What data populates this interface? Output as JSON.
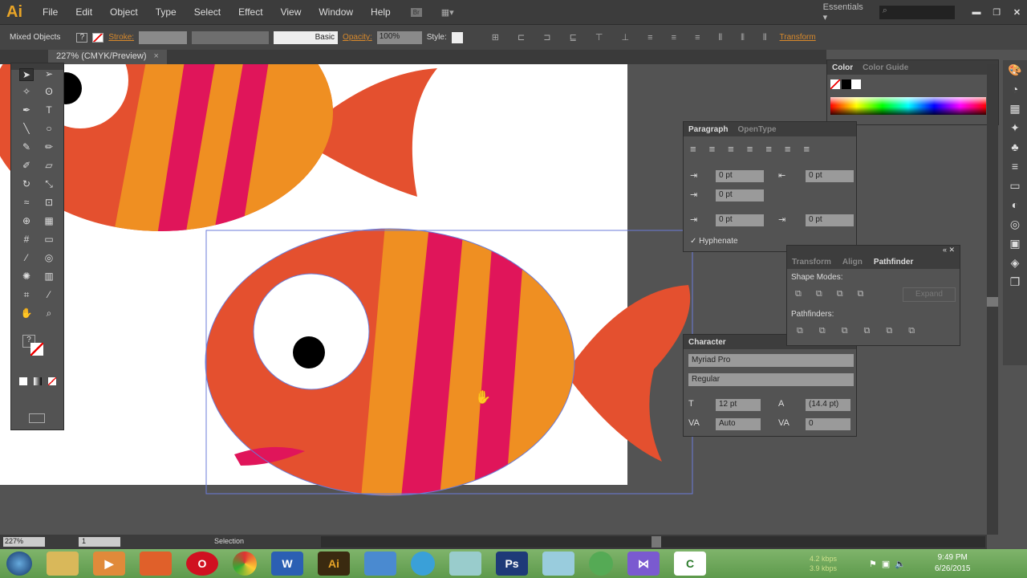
{
  "app": {
    "logo": "Ai",
    "menus": [
      "File",
      "Edit",
      "Object",
      "Type",
      "Select",
      "Effect",
      "View",
      "Window",
      "Help"
    ],
    "workspace": "Essentials",
    "bridge": "Br"
  },
  "control": {
    "selection": "Mixed Objects",
    "fill": "?",
    "stroke_label": "Stroke:",
    "brush": "Basic",
    "opacity_label": "Opacity:",
    "opacity": "100%",
    "style_label": "Style:",
    "transform": "Transform"
  },
  "document": {
    "tab": "227% (CMYK/Preview)"
  },
  "colors": {
    "body": "#e4502f",
    "orange": "#ef8f22",
    "pink": "#e0155a",
    "accent": "#d8892b"
  },
  "color_panel": {
    "tabs": [
      "Color",
      "Color Guide"
    ]
  },
  "paragraph": {
    "tabs": [
      "Paragraph",
      "OpenType"
    ],
    "left_indent": "0 pt",
    "right_indent": "0 pt",
    "first_line": "0 pt",
    "space_before": "0 pt",
    "space_after": "0 pt",
    "hyphenate": "Hyphenate"
  },
  "pathfinder": {
    "tabs": [
      "Transform",
      "Align",
      "Pathfinder"
    ],
    "shape_modes": "Shape Modes:",
    "expand": "Expand",
    "pathfinders": "Pathfinders:"
  },
  "character": {
    "title": "Character",
    "font": "Myriad Pro",
    "style": "Regular",
    "size": "12 pt",
    "leading": "(14.4 pt)",
    "kerning": "Auto",
    "tracking": "0"
  },
  "status": {
    "zoom": "227%",
    "artboard": "1",
    "tool": "Selection"
  },
  "taskbar": {
    "apps": [
      "Windows",
      "Explorer",
      "Media Player",
      "Firefox",
      "Opera",
      "Chrome",
      "Word",
      "Ai",
      "Notes",
      "Clock",
      "Calculator",
      "Ps",
      "Notepad",
      "Globe",
      "Visual Studio",
      "Camtasia"
    ],
    "net_down": "4.2 kbps",
    "net_up": "3.9 kbps",
    "time": "9:49 PM",
    "date": "6/26/2015"
  }
}
